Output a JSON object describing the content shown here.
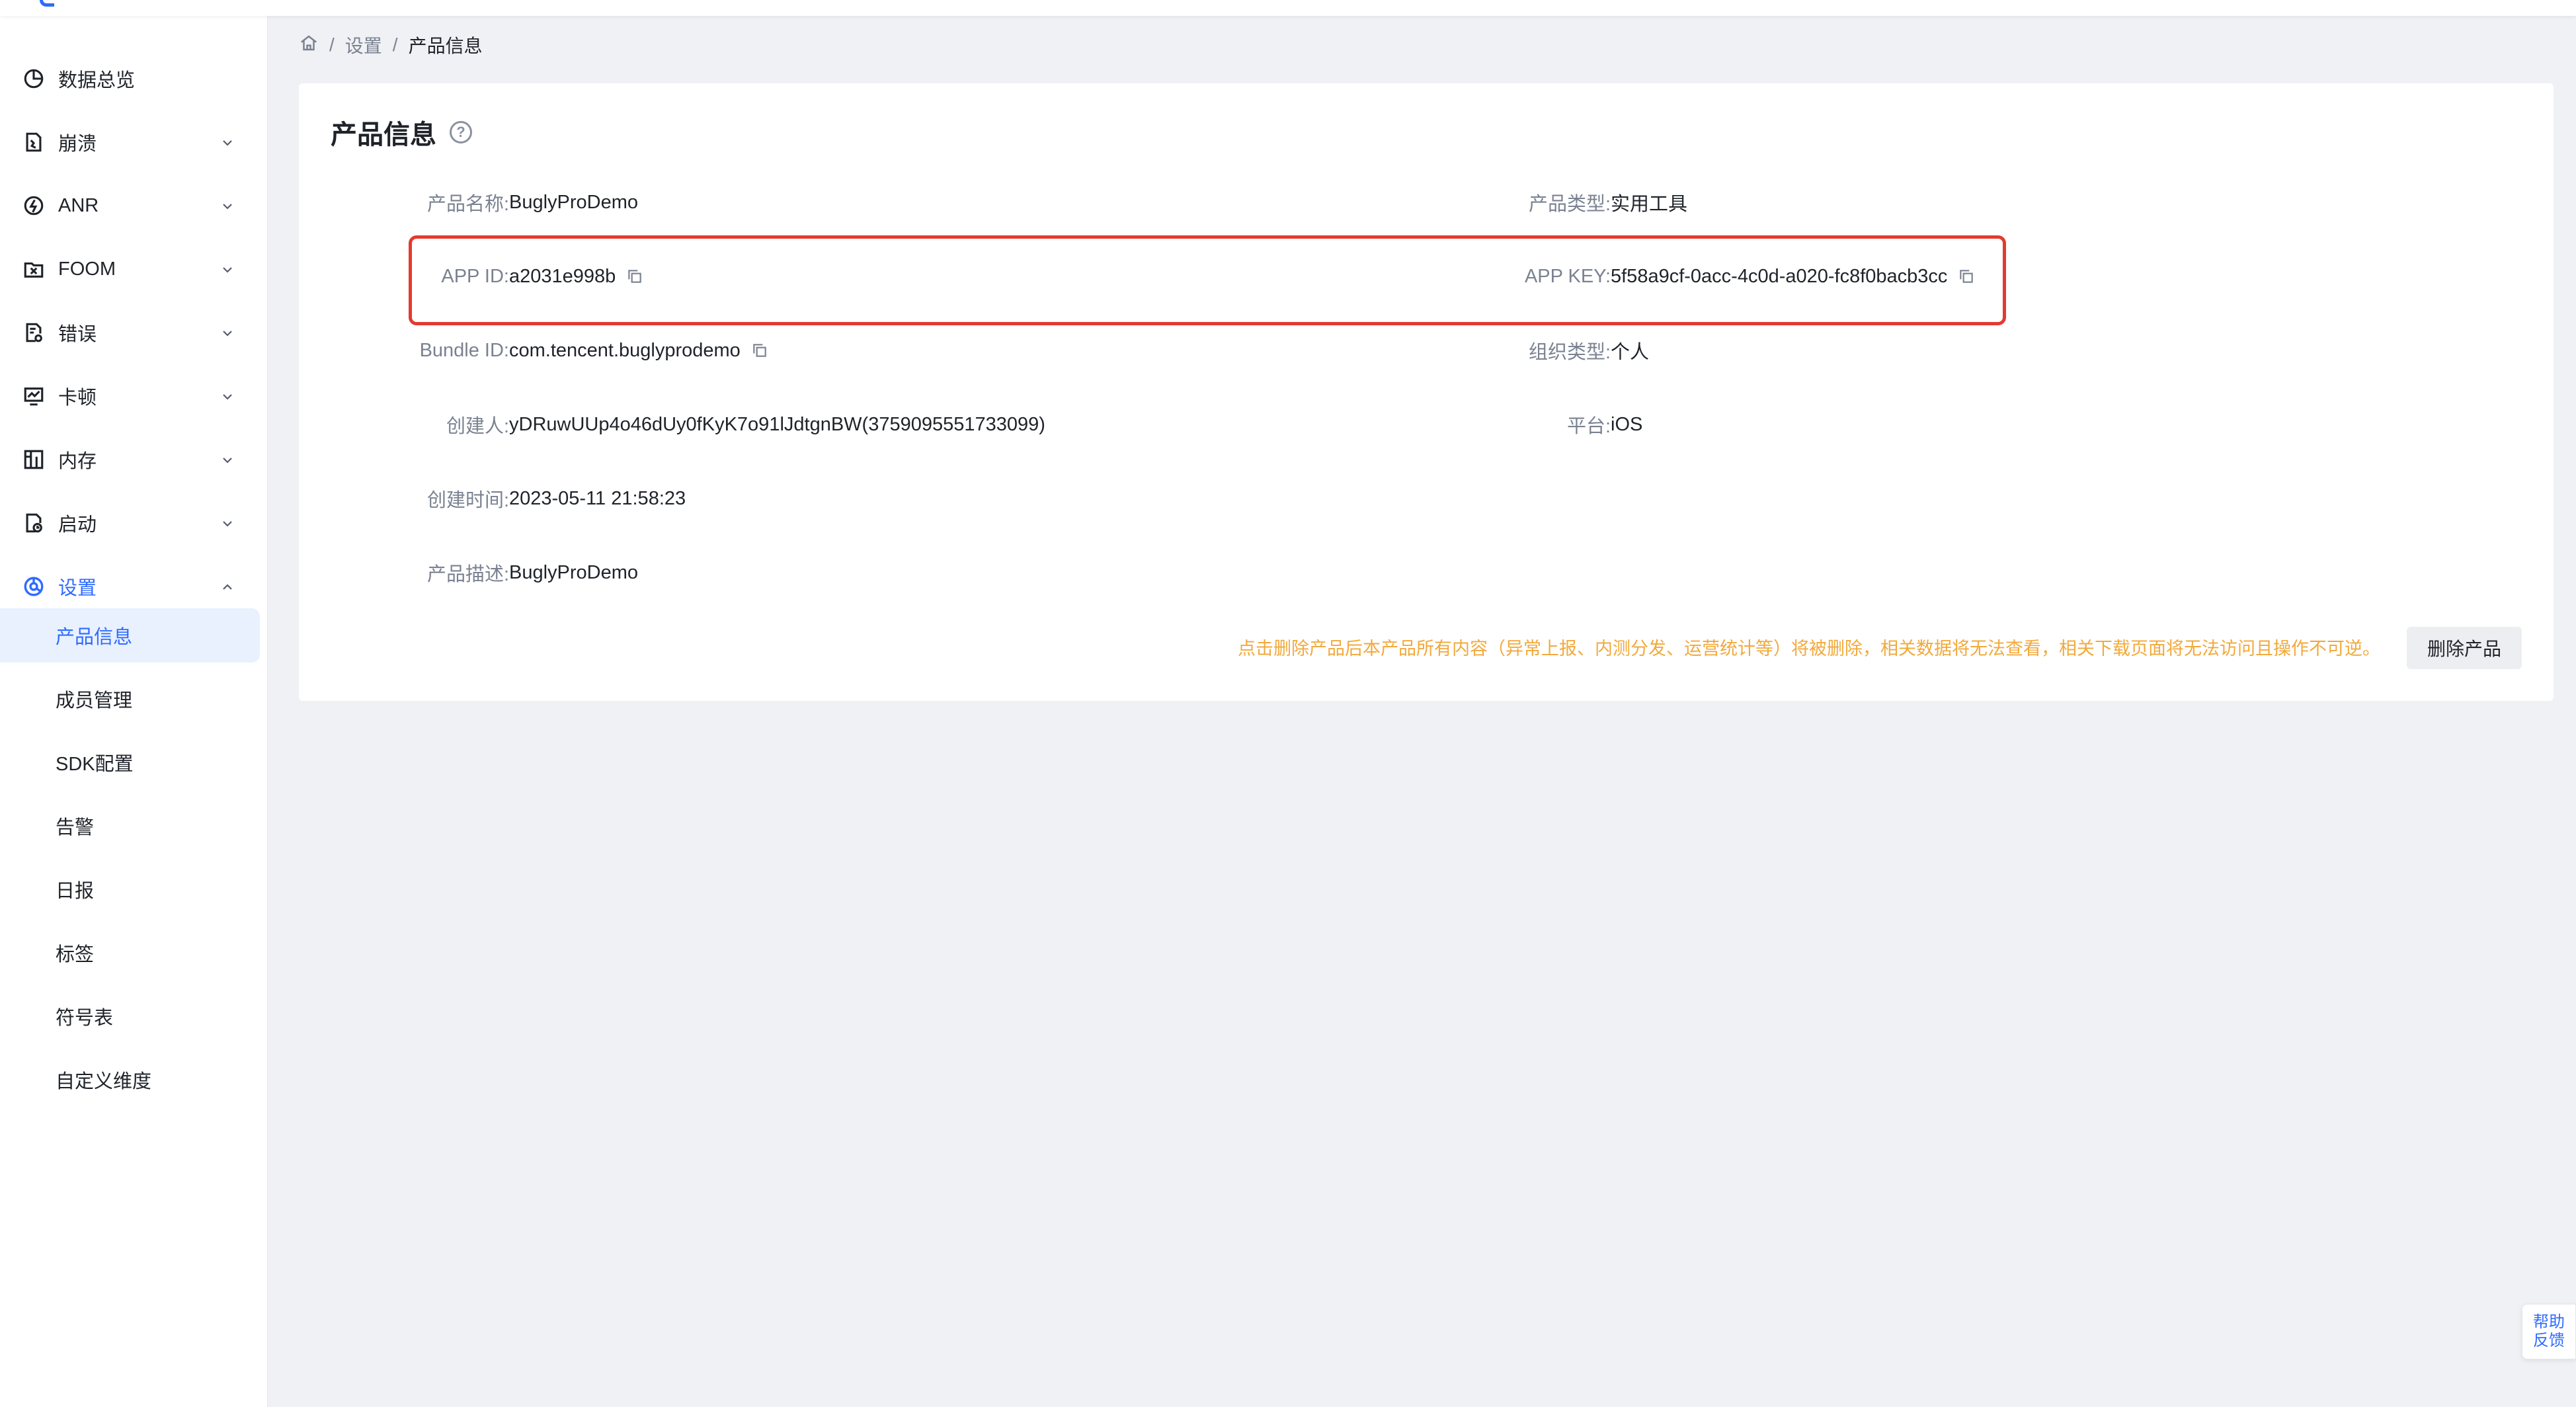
{
  "colors": {
    "accent": "#2f6bff",
    "highlight_border": "#e23b2f",
    "warning_text": "#f2a93b",
    "page_bg": "#f0f1f5"
  },
  "sidebar": {
    "items": [
      {
        "label": "数据总览",
        "icon": "pie-chart-icon"
      },
      {
        "label": "崩溃",
        "icon": "crash-icon"
      },
      {
        "label": "ANR",
        "icon": "anr-icon"
      },
      {
        "label": "FOOM",
        "icon": "foom-icon"
      },
      {
        "label": "错误",
        "icon": "error-report-icon"
      },
      {
        "label": "卡顿",
        "icon": "lag-monitor-icon"
      },
      {
        "label": "内存",
        "icon": "memory-icon"
      },
      {
        "label": "启动",
        "icon": "launch-icon"
      },
      {
        "label": "设置",
        "icon": "settings-icon"
      }
    ],
    "settings_sub_items": [
      {
        "label": "产品信息",
        "active": true
      },
      {
        "label": "成员管理"
      },
      {
        "label": "SDK配置"
      },
      {
        "label": "告警"
      },
      {
        "label": "日报"
      },
      {
        "label": "标签"
      },
      {
        "label": "符号表"
      },
      {
        "label": "自定义维度"
      }
    ]
  },
  "breadcrumb": {
    "home_icon": "home-icon",
    "separator": "/",
    "items": [
      "设置",
      "产品信息"
    ]
  },
  "product_info": {
    "title": "产品信息",
    "help_symbol": "?",
    "fields": {
      "name": {
        "label": "产品名称:",
        "value": "BuglyProDemo"
      },
      "type": {
        "label": "产品类型:",
        "value": "实用工具"
      },
      "app_id": {
        "label": "APP ID:",
        "value": "a2031e998b"
      },
      "app_key": {
        "label": "APP KEY:",
        "value": "5f58a9cf-0acc-4c0d-a020-fc8f0bacb3cc"
      },
      "bundle_id": {
        "label": "Bundle ID:",
        "value": "com.tencent.buglyprodemo"
      },
      "org_type": {
        "label": "组织类型:",
        "value": "个人"
      },
      "creator": {
        "label": "创建人:",
        "value": "yDRuwUUp4o46dUy0fKyK7o91lJdtgnBW(3759095551733099)"
      },
      "platform": {
        "label": "平台:",
        "value": "iOS"
      },
      "created_at": {
        "label": "创建时间:",
        "value": "2023-05-11 21:58:23"
      },
      "description": {
        "label": "产品描述:",
        "value": "BuglyProDemo"
      }
    },
    "delete_warning": "点击删除产品后本产品所有内容（异常上报、内测分发、运营统计等）将被删除，相关数据将无法查看，相关下载页面将无法访问且操作不可逆。",
    "delete_button": "删除产品"
  },
  "help_widget": {
    "line1": "帮助",
    "line2": "反馈"
  }
}
